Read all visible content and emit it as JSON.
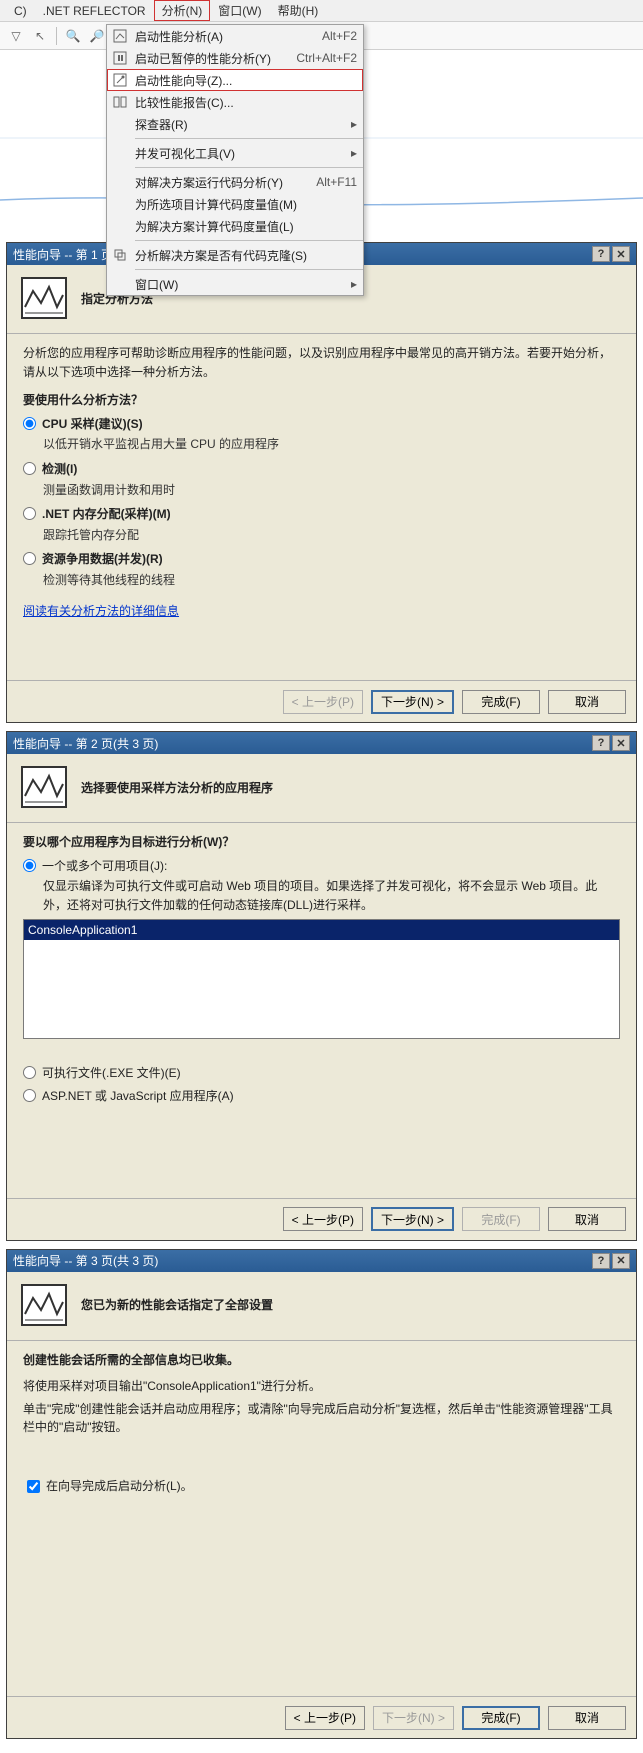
{
  "menubar": {
    "items": [
      "C)",
      ".NET REFLECTOR",
      "分析(N)",
      "窗口(W)",
      "帮助(H)"
    ],
    "active_index": 2
  },
  "dropdown": {
    "items": [
      {
        "icon": "start-perf",
        "label": "启动性能分析(A)",
        "shortcut": "Alt+F2"
      },
      {
        "icon": "start-paused",
        "label": "启动已暂停的性能分析(Y)",
        "shortcut": "Ctrl+Alt+F2"
      },
      {
        "icon": "wizard",
        "label": "启动性能向导(Z)...",
        "shortcut": "",
        "highlighted": true
      },
      {
        "icon": "compare",
        "label": "比较性能报告(C)...",
        "shortcut": ""
      },
      {
        "label": "探查器(R)",
        "submenu": true
      },
      {
        "sep": true
      },
      {
        "label": "并发可视化工具(V)",
        "submenu": true
      },
      {
        "sep": true
      },
      {
        "label": "对解决方案运行代码分析(Y)",
        "shortcut": "Alt+F11"
      },
      {
        "label": "为所选项目计算代码度量值(M)"
      },
      {
        "label": "为解决方案计算代码度量值(L)"
      },
      {
        "sep": true
      },
      {
        "icon": "clone",
        "label": "分析解决方案是否有代码克隆(S)"
      },
      {
        "sep": true
      },
      {
        "label": "窗口(W)",
        "submenu": true
      }
    ]
  },
  "wiz1": {
    "title": "性能向导 -- 第 1 页(共 3 页)",
    "header": "指定分析方法",
    "intro": "分析您的应用程序可帮助诊断应用程序的性能问题，以及识别应用程序中最常见的高开销方法。若要开始分析，请从以下选项中选择一种分析方法。",
    "question": "要使用什么分析方法？",
    "options": [
      {
        "label": "CPU 采样(建议)(S)",
        "desc": "以低开销水平监视占用大量 CPU 的应用程序",
        "checked": true
      },
      {
        "label": "检测(I)",
        "desc": "测量函数调用计数和用时"
      },
      {
        "label": ".NET 内存分配(采样)(M)",
        "desc": "跟踪托管内存分配"
      },
      {
        "label": "资源争用数据(并发)(R)",
        "desc": "检测等待其他线程的线程"
      }
    ],
    "link": "阅读有关分析方法的详细信息",
    "buttons": {
      "prev": "< 上一步(P)",
      "next": "下一步(N) >",
      "finish": "完成(F)",
      "cancel": "取消"
    }
  },
  "wiz2": {
    "title": "性能向导 -- 第 2 页(共 3 页)",
    "header": "选择要使用采样方法分析的应用程序",
    "question": "要以哪个应用程序为目标进行分析(W)？",
    "opt1": "一个或多个可用项目(J):",
    "opt1_desc": "仅显示编译为可执行文件或可启动 Web 项目的项目。如果选择了并发可视化，将不会显示 Web 项目。此外，还将对可执行文件加载的任何动态链接库(DLL)进行采样。",
    "list_item": "ConsoleApplication1",
    "opt2": "可执行文件(.EXE 文件)(E)",
    "opt3": "ASP.NET 或 JavaScript 应用程序(A)",
    "buttons": {
      "prev": "< 上一步(P)",
      "next": "下一步(N) >",
      "finish": "完成(F)",
      "cancel": "取消"
    }
  },
  "wiz3": {
    "title": "性能向导 -- 第 3 页(共 3 页)",
    "header": "您已为新的性能会话指定了全部设置",
    "line1": "创建性能会话所需的全部信息均已收集。",
    "line2": "将使用采样对项目输出\"ConsoleApplication1\"进行分析。",
    "line3": "单击\"完成\"创建性能会话并启动应用程序；或清除\"向导完成后启动分析\"复选框，然后单击\"性能资源管理器\"工具栏中的\"启动\"按钮。",
    "checkbox": "在向导完成后启动分析(L)。",
    "buttons": {
      "prev": "< 上一步(P)",
      "next": "下一步(N) >",
      "finish": "完成(F)",
      "cancel": "取消"
    }
  }
}
